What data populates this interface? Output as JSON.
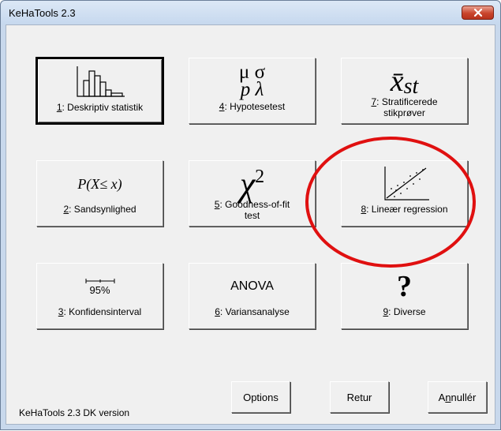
{
  "window": {
    "title": "KeHaTools 2.3"
  },
  "tools": [
    {
      "num": "1",
      "text": ": Deskriptiv statistik",
      "glyph": "histogram"
    },
    {
      "num": "4",
      "text": ": Hypotesetest",
      "glyph_lines": [
        "μ σ",
        "p λ"
      ]
    },
    {
      "num": "7",
      "text": ": Stratificerede",
      "text2": "stikprøver",
      "glyph_text": "x̄",
      "glyph_sub": "st"
    },
    {
      "num": "2",
      "text": ": Sandsynlighed",
      "glyph_text": "P(X≤ x)"
    },
    {
      "num": "5",
      "text": ": Goodness-of-fit",
      "text2": "test",
      "glyph_text": "χ",
      "glyph_sup": "2"
    },
    {
      "num": "8",
      "text": ": Lineær regression",
      "glyph": "scatter"
    },
    {
      "num": "3",
      "text": ": Konfidensinterval",
      "glyph_text": "95%"
    },
    {
      "num": "6",
      "text": ": Variansanalyse",
      "glyph_text": "ANOVA"
    },
    {
      "num": "9",
      "text": ": Diverse",
      "glyph_text": "?"
    }
  ],
  "commands": {
    "options": "Options",
    "retur": "Retur",
    "annuller_pre": "A",
    "annuller_u": "n",
    "annuller_post": "nullér"
  },
  "footer": "KeHaTools 2.3  DK version",
  "annotation": {
    "shape": "ellipse",
    "color": "#e01010",
    "target": "8: Lineær regression"
  }
}
